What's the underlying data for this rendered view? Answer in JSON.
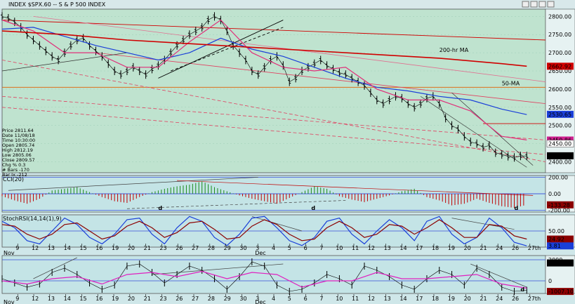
{
  "window": {
    "title": "INDEX $SPX.60 -- S & P 500 INDEX"
  },
  "info_box": {
    "lines": [
      "Price   2811.64",
      "Date    11/08/18",
      "Time    10:30:00",
      "Open   2805.74",
      "High   2812.19",
      "Low    2805.06",
      "Close  2809.57",
      "Chg %  0.3",
      "# Bars -170",
      "Bar Ix -212"
    ]
  },
  "chart_data": [
    {
      "type": "line",
      "panel": "price",
      "ylim": [
        2370,
        2820
      ],
      "yticks": [
        "2800.00",
        "2750.00",
        "2700.00",
        "2650.00",
        "2600.00",
        "2550.00",
        "2500.00",
        "2450.00",
        "2400.00"
      ],
      "ytick_values": [
        2800,
        2750,
        2700,
        2650,
        2600,
        2550,
        2500,
        2450,
        2400
      ],
      "annotations": [
        "200-hr MA",
        "50-MA"
      ],
      "price_labels": [
        {
          "text": "2662.92",
          "value": 2662.92,
          "color": "#d00000"
        },
        {
          "text": "2530.65",
          "value": 2530.65,
          "color": "#1a3fd9"
        },
        {
          "text": "2459.86",
          "value": 2459.86,
          "color": "#d02090"
        },
        {
          "text": "2450.00",
          "value": 2450.0,
          "color": "#ffffff"
        },
        {
          "text": "2416.57",
          "value": 2416.57,
          "color": "#000000"
        }
      ],
      "series": [
        {
          "name": "close",
          "color": "#000000",
          "x": [
            0,
            2,
            4,
            6,
            8,
            10,
            12,
            14,
            16,
            18,
            20,
            22,
            24,
            26,
            28,
            30,
            32,
            34,
            36,
            38,
            40,
            42,
            44,
            46,
            48,
            50,
            52,
            54,
            56,
            58,
            60,
            62,
            64,
            66,
            68,
            70,
            72,
            74,
            76,
            78,
            80,
            82,
            84,
            86,
            88,
            90,
            92,
            94,
            96,
            98,
            100,
            102,
            104,
            106,
            108,
            110,
            112,
            114,
            116,
            118,
            120,
            122,
            124,
            126,
            128,
            130,
            132,
            134,
            136,
            138,
            140,
            142,
            144,
            146,
            148,
            150,
            152,
            154,
            156,
            158,
            160,
            162,
            164,
            166,
            168
          ],
          "values": [
            2800,
            2795,
            2785,
            2770,
            2750,
            2735,
            2720,
            2705,
            2690,
            2680,
            2700,
            2720,
            2735,
            2740,
            2720,
            2705,
            2690,
            2670,
            2650,
            2640,
            2650,
            2660,
            2650,
            2640,
            2655,
            2665,
            2680,
            2700,
            2720,
            2735,
            2750,
            2760,
            2770,
            2790,
            2800,
            2790,
            2760,
            2720,
            2700,
            2680,
            2650,
            2640,
            2660,
            2680,
            2690,
            2665,
            2620,
            2630,
            2650,
            2660,
            2670,
            2680,
            2665,
            2655,
            2645,
            2640,
            2630,
            2620,
            2610,
            2590,
            2570,
            2560,
            2570,
            2580,
            2575,
            2560,
            2550,
            2560,
            2575,
            2580,
            2560,
            2520,
            2500,
            2490,
            2470,
            2455,
            2450,
            2440,
            2445,
            2425,
            2420,
            2415,
            2412,
            2416,
            2416
          ]
        },
        {
          "name": "50-MA",
          "color": "#1a3fd9",
          "x": [
            0,
            10,
            20,
            30,
            40,
            50,
            60,
            70,
            80,
            90,
            100,
            110,
            120,
            130,
            140,
            150,
            160,
            168
          ],
          "values": [
            2765,
            2770,
            2745,
            2720,
            2700,
            2680,
            2700,
            2740,
            2710,
            2690,
            2660,
            2630,
            2605,
            2595,
            2580,
            2570,
            2545,
            2530
          ]
        },
        {
          "name": "pink-MA",
          "color": "#e0307a",
          "x": [
            0,
            10,
            20,
            30,
            40,
            50,
            60,
            70,
            80,
            90,
            100,
            110,
            120,
            130,
            140,
            150,
            160,
            168
          ],
          "values": [
            2790,
            2760,
            2700,
            2700,
            2660,
            2660,
            2730,
            2790,
            2700,
            2660,
            2650,
            2660,
            2600,
            2570,
            2570,
            2540,
            2470,
            2460
          ]
        },
        {
          "name": "200-hr MA",
          "color": "#d00000",
          "x": [
            0,
            20,
            40,
            60,
            80,
            100,
            120,
            140,
            160,
            168
          ],
          "values": [
            2760,
            2750,
            2735,
            2725,
            2715,
            2705,
            2695,
            2685,
            2670,
            2663
          ]
        }
      ]
    },
    {
      "type": "bar",
      "panel": "CCI",
      "title": "CCI(20)",
      "ylim": [
        -220,
        220
      ],
      "yticks": [
        "200.00",
        "0.00",
        "-200.00"
      ],
      "ytick_values": [
        200,
        0,
        -200
      ],
      "price_label": {
        "text": "-133.28",
        "value": -133.28,
        "color": "#8b0000"
      },
      "annotations": [
        "d",
        "d",
        "d"
      ],
      "x": [
        0,
        4,
        8,
        12,
        16,
        20,
        24,
        28,
        32,
        36,
        40,
        44,
        48,
        52,
        56,
        60,
        64,
        68,
        72,
        76,
        80,
        84,
        88,
        92,
        96,
        100,
        104,
        108,
        112,
        116,
        120,
        124,
        128,
        132,
        136,
        140,
        144,
        148,
        152,
        156,
        160,
        164,
        168
      ],
      "values": [
        -30,
        -80,
        -120,
        -60,
        40,
        60,
        80,
        20,
        -40,
        -90,
        -110,
        -40,
        20,
        60,
        90,
        110,
        150,
        80,
        30,
        -20,
        -60,
        -90,
        -120,
        -50,
        20,
        90,
        60,
        -30,
        -70,
        -100,
        -60,
        -20,
        30,
        60,
        -40,
        -80,
        -140,
        -120,
        -60,
        -110,
        -150,
        -170,
        -133
      ]
    },
    {
      "type": "line",
      "panel": "StochRSI",
      "title": "StochRSI(14,14(1),9)",
      "ylim": [
        0,
        100
      ],
      "yticks": [
        "50.00"
      ],
      "ytick_values": [
        50
      ],
      "price_labels": [
        {
          "text": "24.92",
          "value": 24.92,
          "color": "#8b0000"
        },
        {
          "text": "3.81",
          "value": 3.81,
          "color": "#1a3fd9"
        }
      ],
      "series": [
        {
          "name": "%K",
          "color": "#1a3fd9",
          "x": [
            0,
            4,
            8,
            12,
            16,
            20,
            24,
            28,
            32,
            36,
            40,
            44,
            48,
            52,
            56,
            60,
            64,
            68,
            72,
            76,
            80,
            84,
            88,
            92,
            96,
            100,
            104,
            108,
            112,
            116,
            120,
            124,
            128,
            132,
            136,
            140,
            144,
            148,
            152,
            156,
            160,
            164,
            168
          ],
          "values": [
            80,
            60,
            20,
            10,
            50,
            90,
            70,
            30,
            10,
            40,
            85,
            90,
            40,
            10,
            60,
            95,
            80,
            30,
            5,
            40,
            90,
            95,
            60,
            20,
            5,
            30,
            80,
            90,
            40,
            10,
            50,
            85,
            60,
            20,
            80,
            95,
            40,
            10,
            30,
            90,
            60,
            15,
            4
          ]
        },
        {
          "name": "%D",
          "color": "#8b0000",
          "x": [
            0,
            4,
            8,
            12,
            16,
            20,
            24,
            28,
            32,
            36,
            40,
            44,
            48,
            52,
            56,
            60,
            64,
            68,
            72,
            76,
            80,
            84,
            88,
            92,
            96,
            100,
            104,
            108,
            112,
            116,
            120,
            124,
            128,
            132,
            136,
            140,
            144,
            148,
            152,
            156,
            160,
            164,
            168
          ],
          "values": [
            70,
            65,
            40,
            25,
            40,
            70,
            75,
            50,
            25,
            35,
            65,
            80,
            60,
            30,
            45,
            75,
            80,
            55,
            25,
            30,
            65,
            85,
            70,
            40,
            20,
            25,
            60,
            80,
            60,
            30,
            40,
            70,
            65,
            40,
            60,
            85,
            60,
            30,
            30,
            70,
            65,
            35,
            25
          ]
        }
      ]
    },
    {
      "type": "line",
      "panel": "lower",
      "ylim": [
        -1200,
        2400
      ],
      "yticks": [
        "2000",
        "0"
      ],
      "ytick_values": [
        2000,
        0
      ],
      "price_labels": [
        {
          "text": "-1007.10",
          "value": -1007.1,
          "color": "#8b0000"
        },
        {
          "text": "1698",
          "value": 1698,
          "color": "#000000"
        }
      ],
      "annotations": [
        "d"
      ],
      "series": [
        {
          "name": "indicator",
          "color": "#000000",
          "x": [
            0,
            4,
            8,
            12,
            16,
            20,
            24,
            28,
            32,
            36,
            40,
            44,
            48,
            52,
            56,
            60,
            64,
            68,
            72,
            76,
            80,
            84,
            88,
            92,
            96,
            100,
            104,
            108,
            112,
            116,
            120,
            124,
            128,
            132,
            136,
            140,
            144,
            148,
            152,
            156,
            160,
            164,
            168
          ],
          "values": [
            200,
            -200,
            -600,
            -300,
            800,
            1200,
            600,
            -200,
            -800,
            -400,
            1400,
            1600,
            800,
            -200,
            600,
            1400,
            1000,
            200,
            -800,
            400,
            1800,
            1400,
            -400,
            -1000,
            -800,
            -200,
            600,
            200,
            -400,
            1400,
            1000,
            400,
            -400,
            -800,
            200,
            1000,
            600,
            -400,
            1200,
            600,
            -600,
            -1000,
            -900
          ]
        },
        {
          "name": "average",
          "color": "#e020c0",
          "x": [
            0,
            8,
            16,
            24,
            32,
            40,
            48,
            56,
            64,
            72,
            80,
            88,
            96,
            104,
            112,
            120,
            128,
            136,
            144,
            152,
            160,
            168
          ],
          "values": [
            0,
            -300,
            200,
            400,
            -300,
            600,
            800,
            400,
            900,
            200,
            800,
            600,
            -600,
            0,
            0,
            800,
            200,
            200,
            400,
            600,
            -300,
            -700
          ]
        }
      ]
    }
  ],
  "x_axis": {
    "month_labels": [
      "Nov",
      "Dec"
    ],
    "day_labels": [
      "9",
      "12",
      "13",
      "14",
      "15",
      "16",
      "19",
      "20",
      "21",
      "23",
      "26",
      "27",
      "28",
      "29",
      "30",
      "3",
      "4",
      "5",
      "6",
      "7",
      "10",
      "11",
      "12",
      "13",
      "14",
      "17",
      "18",
      "19",
      "20",
      "21",
      "24",
      "26",
      "27th"
    ]
  }
}
